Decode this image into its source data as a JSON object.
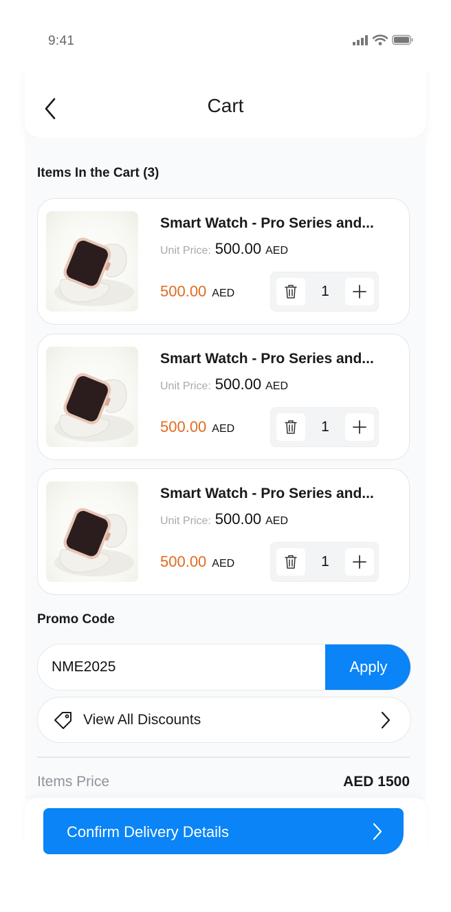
{
  "status_bar": {
    "time": "9:41"
  },
  "header": {
    "title": "Cart"
  },
  "cart": {
    "section_title": "Items In the Cart (3)",
    "items": [
      {
        "name": "Smart Watch - Pro Series and...",
        "unit_label": "Unit Price:",
        "unit_price": "500.00",
        "unit_currency": "AED",
        "total": "500.00",
        "total_currency": "AED",
        "quantity": "1"
      },
      {
        "name": "Smart Watch - Pro Series and...",
        "unit_label": "Unit Price:",
        "unit_price": "500.00",
        "unit_currency": "AED",
        "total": "500.00",
        "total_currency": "AED",
        "quantity": "1"
      },
      {
        "name": "Smart Watch - Pro Series and...",
        "unit_label": "Unit Price:",
        "unit_price": "500.00",
        "unit_currency": "AED",
        "total": "500.00",
        "total_currency": "AED",
        "quantity": "1"
      }
    ]
  },
  "promo": {
    "section_title": "Promo Code",
    "value": "NME2025",
    "apply_label": "Apply",
    "view_discounts_label": "View All Discounts"
  },
  "summary": {
    "items_price_label": "Items Price",
    "items_price_value": "AED 1500"
  },
  "footer": {
    "confirm_label": "Confirm Delivery Details"
  },
  "colors": {
    "accent": "#0a84f6",
    "price": "#e26a1e",
    "muted": "#8e939a"
  },
  "icons": [
    "signal-icon",
    "wifi-icon",
    "battery-icon",
    "back-chevron-icon",
    "trash-icon",
    "plus-icon",
    "tag-icon",
    "chevron-right-icon"
  ]
}
